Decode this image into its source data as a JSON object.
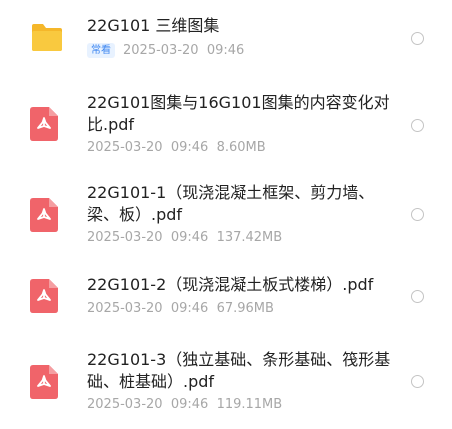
{
  "files": [
    {
      "icon": "folder-icon",
      "name": "22G101 三维图集",
      "badge": "常看",
      "date": "2025-03-20",
      "time": "09:46",
      "size": ""
    },
    {
      "icon": "pdf-icon",
      "name": "22G101图集与16G101图集的内容变化对比.pdf",
      "date": "2025-03-20",
      "time": "09:46",
      "size": "8.60MB"
    },
    {
      "icon": "pdf-icon",
      "name": "22G101-1（现浇混凝土框架、剪力墙、梁、板）.pdf",
      "date": "2025-03-20",
      "time": "09:46",
      "size": "137.42MB"
    },
    {
      "icon": "pdf-icon",
      "name": "22G101-2（现浇混凝土板式楼梯）.pdf",
      "date": "2025-03-20",
      "time": "09:46",
      "size": "67.96MB"
    },
    {
      "icon": "pdf-icon",
      "name": "22G101-3（独立基础、条形基础、筏形基础、桩基础）.pdf",
      "date": "2025-03-20",
      "time": "09:46",
      "size": "119.11MB"
    }
  ],
  "colors": {
    "folder": "#f7c233",
    "pdf": "#f0646a",
    "badge_text": "#3d86f0",
    "meta_text": "#a7a7a7"
  }
}
